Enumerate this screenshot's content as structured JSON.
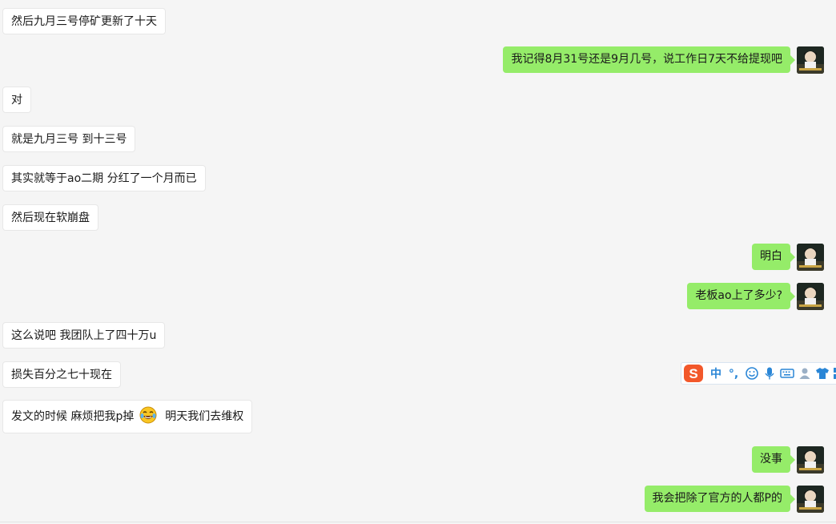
{
  "messages": [
    {
      "side": "in",
      "text": "然后九月三号停矿更新了十天"
    },
    {
      "side": "out",
      "text": "我记得8月31号还是9月几号，说工作日7天不给提现吧"
    },
    {
      "side": "in",
      "text": "对"
    },
    {
      "side": "in",
      "text": "就是九月三号 到十三号"
    },
    {
      "side": "in",
      "text": "其实就等于ao二期 分红了一个月而已"
    },
    {
      "side": "in",
      "text": "然后现在软崩盘"
    },
    {
      "side": "out",
      "text": "明白"
    },
    {
      "side": "out",
      "text": "老板ao上了多少?"
    },
    {
      "side": "in",
      "text": "这么说吧 我团队上了四十万u"
    },
    {
      "side": "in",
      "text": "损失百分之七十现在"
    },
    {
      "side": "in",
      "text_before": "发文的时候 麻烦把我p掉",
      "emoji": "laughing-tears-emoji",
      "text_after": "明天我们去维权"
    },
    {
      "side": "out",
      "text": "没事"
    },
    {
      "side": "out",
      "text": "我会把除了官方的人都P的"
    }
  ],
  "ime_toolbar": {
    "logo": "S",
    "mode": "中",
    "punct": "°,",
    "icons": [
      "emoji-face-icon",
      "microphone-icon",
      "keyboard-icon",
      "user-icon",
      "tshirt-skin-icon",
      "grid-menu-icon"
    ]
  },
  "colors": {
    "background": "#f5f5f5",
    "incoming_bubble": "#ffffff",
    "outgoing_bubble": "#95ec69",
    "ime_logo": "#f2582b",
    "ime_icon": "#2a86d6"
  }
}
